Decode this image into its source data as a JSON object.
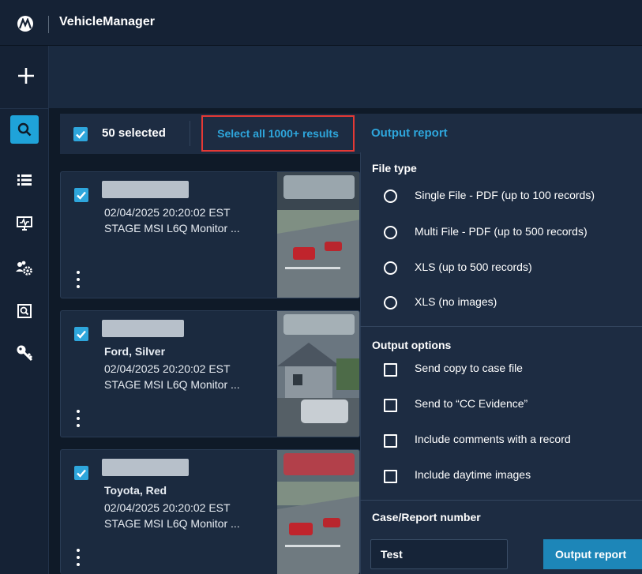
{
  "app": {
    "title": "VehicleManager"
  },
  "rail": {
    "icons": [
      "search-icon",
      "list-icon",
      "monitor-icon",
      "users-gear-icon",
      "search-document-icon",
      "key-icon"
    ]
  },
  "toolbar": {
    "selected_label": "50 selected",
    "select_all_label": "Select all 1000+ results",
    "output_report_label": "Output report"
  },
  "records": [
    {
      "vehicle": "",
      "timestamp": "02/04/2025 20:20:02 EST",
      "source": "STAGE MSI L6Q Monitor ..."
    },
    {
      "vehicle": "Ford, Silver",
      "timestamp": "02/04/2025 20:20:02 EST",
      "source": "STAGE MSI L6Q Monitor ..."
    },
    {
      "vehicle": "Toyota, Red",
      "timestamp": "02/04/2025 20:20:02 EST",
      "source": "STAGE MSI L6Q Monitor ..."
    }
  ],
  "panel": {
    "file_type_heading": "File type",
    "file_types": [
      "Single File - PDF (up to 100 records)",
      "Multi File - PDF (up to 500 records)",
      "XLS (up to 500 records)",
      "XLS (no images)"
    ],
    "output_options_heading": "Output options",
    "output_options": [
      "Send copy to case file",
      "Send to “CC Evidence”",
      "Include comments with a record",
      "Include daytime images"
    ],
    "case_heading": "Case/Report number",
    "case_value": "Test",
    "output_button_label": "Output report"
  },
  "colors": {
    "accent": "#2ea6dc",
    "highlight_border": "#e53935",
    "background": "#0f1a28"
  }
}
